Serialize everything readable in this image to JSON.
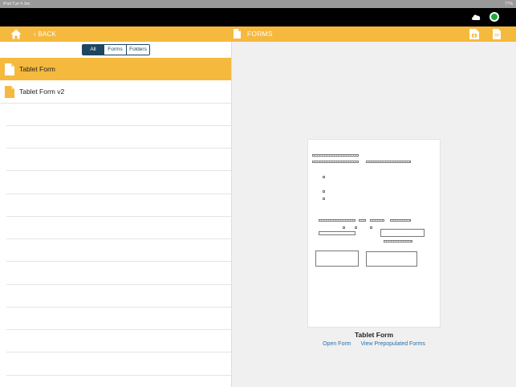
{
  "status_bar": {
    "left": "iPad  Tue 4 Jan",
    "right": "77%"
  },
  "nav": {
    "back_label": "BACK",
    "title": "FORMS"
  },
  "segments": [
    {
      "label": "All",
      "selected": true
    },
    {
      "label": "Forms",
      "selected": false
    },
    {
      "label": "Folders",
      "selected": false
    }
  ],
  "list": {
    "items": [
      {
        "label": "Tablet Form",
        "selected": true
      },
      {
        "label": "Tablet Form v2",
        "selected": false
      }
    ]
  },
  "preview": {
    "form_title": "Tablet Form",
    "open_label": "Open Form",
    "prepopulated_label": "View Prepopulated Forms"
  },
  "colors": {
    "accent": "#f5b93e",
    "segment": "#1d4660",
    "link": "#2a6fa8",
    "sync_status": "#1fa83a"
  },
  "icons": [
    "home-icon",
    "chevron-left-icon",
    "document-icon",
    "cloud-icon",
    "sync-status-icon",
    "camera-document-icon",
    "new-document-icon",
    "file-icon"
  ]
}
